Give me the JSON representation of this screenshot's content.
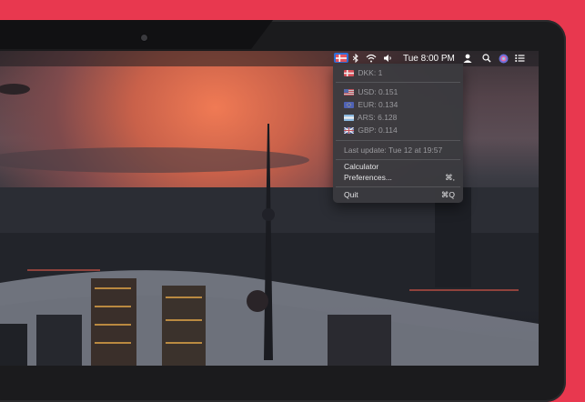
{
  "menubar": {
    "clock": "Tue 8:00 PM"
  },
  "menu": {
    "base": {
      "text": "DKK: 1",
      "flag": "dk"
    },
    "rates": [
      {
        "text": "USD: 0.151",
        "flag": "us"
      },
      {
        "text": "EUR: 0.134",
        "flag": "eu"
      },
      {
        "text": "ARS: 6.128",
        "flag": "ar"
      },
      {
        "text": "GBP: 0.114",
        "flag": "gb"
      }
    ],
    "last_update": "Last update: Tue 12 at 19:57",
    "calculator": "Calculator",
    "preferences": "Preferences...",
    "preferences_shortcut": "⌘,",
    "quit": "Quit",
    "quit_shortcut": "⌘Q"
  },
  "colors": {
    "background": "#e8384f",
    "menu_bg": "#3a3a3e",
    "status_flag_bg": "#2f6fd9"
  }
}
